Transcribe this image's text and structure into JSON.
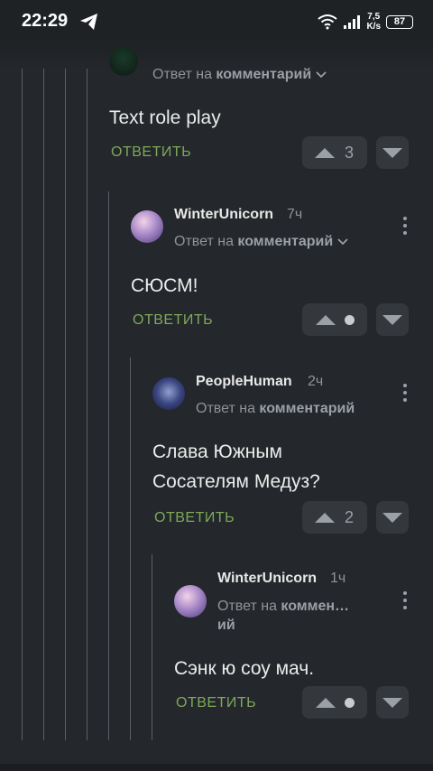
{
  "status": {
    "time": "22:29",
    "speed_top": "7,5",
    "speed_bottom": "K/s",
    "battery": "87"
  },
  "reply_label": "ОТВЕТИТЬ",
  "reply_to_prefix": "Ответ на",
  "reply_to_link": "комментарий",
  "comments": [
    {
      "username": "",
      "time": "",
      "text": "Text role play",
      "score": "3"
    },
    {
      "username": "WinterUnicorn",
      "time": "7ч",
      "text": "СЮСМ!",
      "score": ""
    },
    {
      "username": "PeopleHuman",
      "time": "2ч",
      "text_line1": "Слава Южным",
      "text_line2": "Сосателям Медуз?",
      "score": "2"
    },
    {
      "username": "WinterUnicorn",
      "time": "1ч",
      "reply_to_link_line1": "коммен…",
      "reply_to_link_line2": "ий",
      "text": "Сэнк ю соу мач.",
      "score": ""
    }
  ]
}
